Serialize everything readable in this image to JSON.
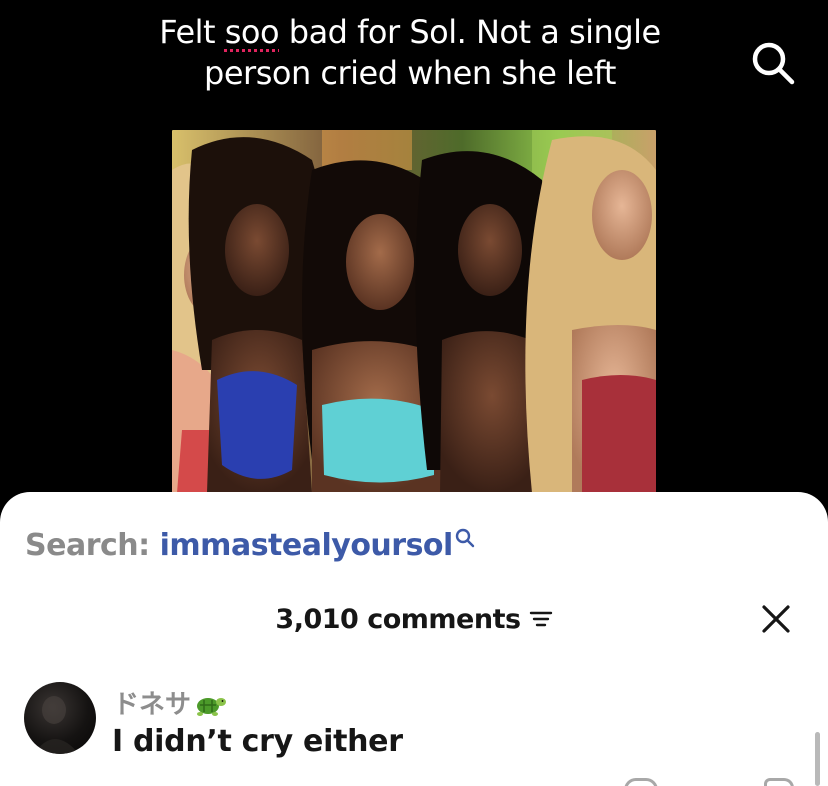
{
  "video": {
    "caption_part1": "Felt ",
    "caption_flagged": "soo",
    "caption_part2": " bad for Sol. Not a single person cried when she left"
  },
  "comments_panel": {
    "search_prefix": "Search:",
    "search_term": "immastealyoursol",
    "count_label": "3,010 comments"
  },
  "comments": [
    {
      "username": "ドネサ",
      "text": "I didn’t cry either"
    }
  ],
  "colors": {
    "search_term": "#3d5aa8",
    "spellcheck_underline": "#e0245e",
    "muted_text": "#8a8a8a"
  },
  "icons": [
    "search-icon",
    "search-mini-icon",
    "sort-icon",
    "close-icon",
    "turtle-emoji",
    "like-icon",
    "reply-icon"
  ]
}
